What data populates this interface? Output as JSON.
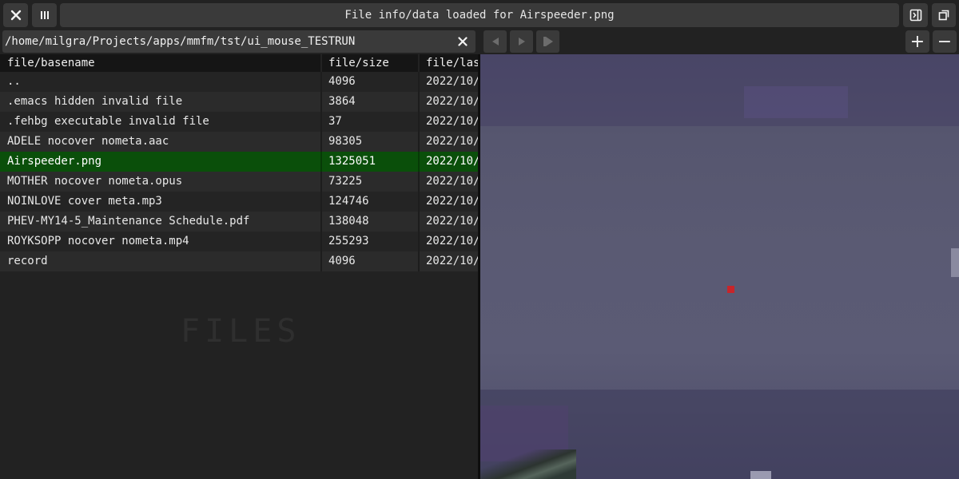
{
  "titlebar": {
    "message": "File info/data loaded for Airspeeder.png"
  },
  "toolbar": {
    "close_icon": "close-icon",
    "columns_icon": "columns-icon",
    "side_panel_icon": "side-panel-icon",
    "fullscreen_icon": "fullscreen-icon",
    "zoom_in_label": "+",
    "zoom_out_label": "−"
  },
  "pathbar": {
    "value": "/home/milgra/Projects/apps/mmfm/tst/ui_mouse_TESTRUN"
  },
  "filelist": {
    "columns": [
      "file/basename",
      "file/size",
      "file/las"
    ],
    "rows": [
      {
        "name": "..",
        "size": "4096",
        "date": "2022/10/"
      },
      {
        "name": ".emacs hidden invalid file",
        "size": "3864",
        "date": "2022/10/"
      },
      {
        "name": ".fehbg executable invalid file",
        "size": "37",
        "date": "2022/10/"
      },
      {
        "name": "ADELE nocover nometa.aac",
        "size": "98305",
        "date": "2022/10/"
      },
      {
        "name": "Airspeeder.png",
        "size": "1325051",
        "date": "2022/10/"
      },
      {
        "name": "MOTHER nocover nometa.opus",
        "size": "73225",
        "date": "2022/10/"
      },
      {
        "name": "NOINLOVE cover meta.mp3",
        "size": "124746",
        "date": "2022/10/"
      },
      {
        "name": "PHEV-MY14-5_Maintenance Schedule.pdf",
        "size": "138048",
        "date": "2022/10/"
      },
      {
        "name": "ROYKSOPP nocover nometa.mp4",
        "size": "255293",
        "date": "2022/10/"
      },
      {
        "name": "record",
        "size": "4096",
        "date": "2022/10/"
      }
    ],
    "selected_index": 4,
    "watermark": "FILES"
  },
  "colors": {
    "selected_row": "#0a4f0a",
    "button_bg": "#3a3a3a",
    "background": "#222222"
  }
}
